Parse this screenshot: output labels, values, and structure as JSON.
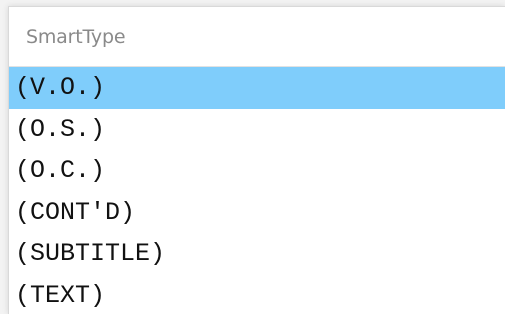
{
  "smarttype": {
    "title": "SmartType",
    "selected_index": 0,
    "items": [
      {
        "label": "(V.O.)"
      },
      {
        "label": "(O.S.)"
      },
      {
        "label": "(O.C.)"
      },
      {
        "label": "(CONT'D)"
      },
      {
        "label": "(SUBTITLE)"
      },
      {
        "label": "(TEXT)"
      }
    ]
  },
  "colors": {
    "selection": "#7fcdfb",
    "header_text": "#8a8a8a",
    "item_text": "#111111"
  }
}
